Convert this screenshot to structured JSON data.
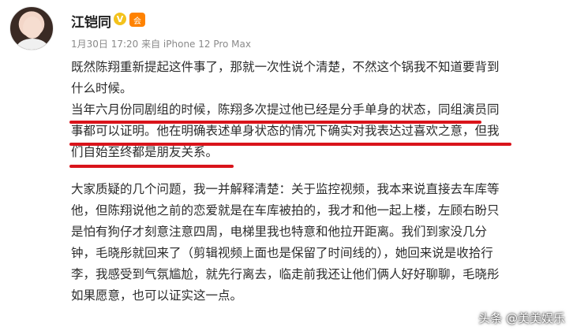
{
  "post": {
    "author_name": "江铠同",
    "badge_v": "V",
    "badge_member": "会",
    "meta_line": "1月30日 17:20 来自 iPhone 12 Pro Max",
    "paragraph1": {
      "line1": "既然陈翔重新提起这件事了，那就一次性说个清楚，不然这个锅我不知道要背到",
      "line2": "什么时候。",
      "line3": "当年六月份同剧组的时候，陈翔多次提过他已经是分手单身的状态，同组演员同",
      "line4": "事都可以证明。他在明确表述单身状态的情况下确实对我表达过喜欢之意，但我",
      "line5": "们自始至终都是朋友关系。"
    },
    "paragraph2": {
      "line1": "大家质疑的几个问题，我一并解释清楚：关于监控视频，我本来说直接去车库等",
      "line2": "他，但陈翔说他之前的恋爱就是在车库被拍的，我才和他一起上楼，左顾右盼只",
      "line3": "是怕有狗仔才刻意注意四周，电梯里我也特意和他拉开距离。我们到家没几分",
      "line4": "钟，毛晓彤就回来了（剪辑视频上面也是保留了时间线的），她回来说是收拾行",
      "line5": "李，我感受到气氛尴尬，就先行离去，临走前我还让他们俩人好好聊聊，毛晓彤",
      "line6": "如果愿意，也可以证实这一点。"
    }
  },
  "watermark": "头条 @美美娱乐",
  "colors": {
    "underline": "#d9141b",
    "meta": "#8a8a8a",
    "text": "#2b2b2b"
  }
}
